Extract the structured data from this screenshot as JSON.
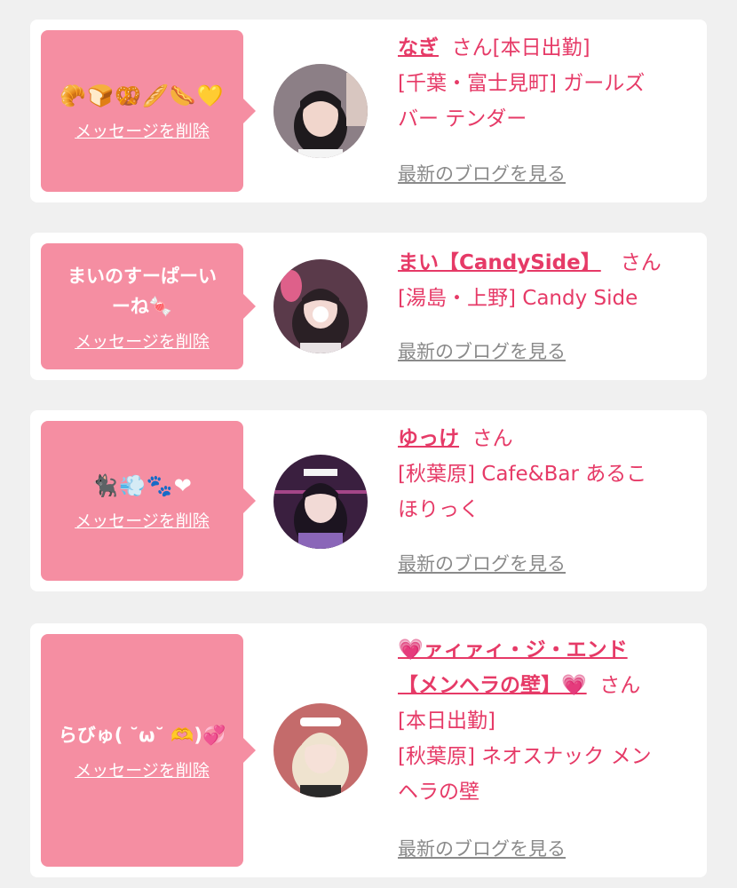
{
  "delete_label": "メッセージを削除",
  "blog_label": "最新のブログを見る",
  "cards": [
    {
      "message_emoji": "🥐🍞🥨🥖🌭💛",
      "name": "なぎ",
      "san": "さん",
      "lines": [
        "[本日出勤]",
        "[千葉・富士見町] ガールズ",
        "バー テンダー"
      ]
    },
    {
      "message_lines": [
        "まいのすーぱーい",
        "ーね🍬"
      ],
      "name": "まい【CandySide】",
      "san": "さん",
      "lines": [
        "[湯島・上野] Candy Side"
      ]
    },
    {
      "message_emoji": "🐈‍⬛💨🐾❤",
      "name": "ゆっけ",
      "san": "さん",
      "lines": [
        "[秋葉原] Cafe&Bar あるこ",
        "ほりっく"
      ]
    },
    {
      "message_lines": [
        "らびゅ( ˘ω˘ 🫶)💞"
      ],
      "name_line1": "💗ァィァィ・ジ・エンド",
      "name_line2": "【メンヘラの壁】💗",
      "san": "さん",
      "lines": [
        "[本日出勤]",
        "[秋葉原] ネオスナック メン",
        "ヘラの壁"
      ]
    }
  ],
  "colors": {
    "bubble": "#f58ea2",
    "accent": "#e63a67",
    "link_gray": "#8a8a8a",
    "background": "#f0f0f0"
  },
  "icons": [
    "avatar-photo"
  ]
}
